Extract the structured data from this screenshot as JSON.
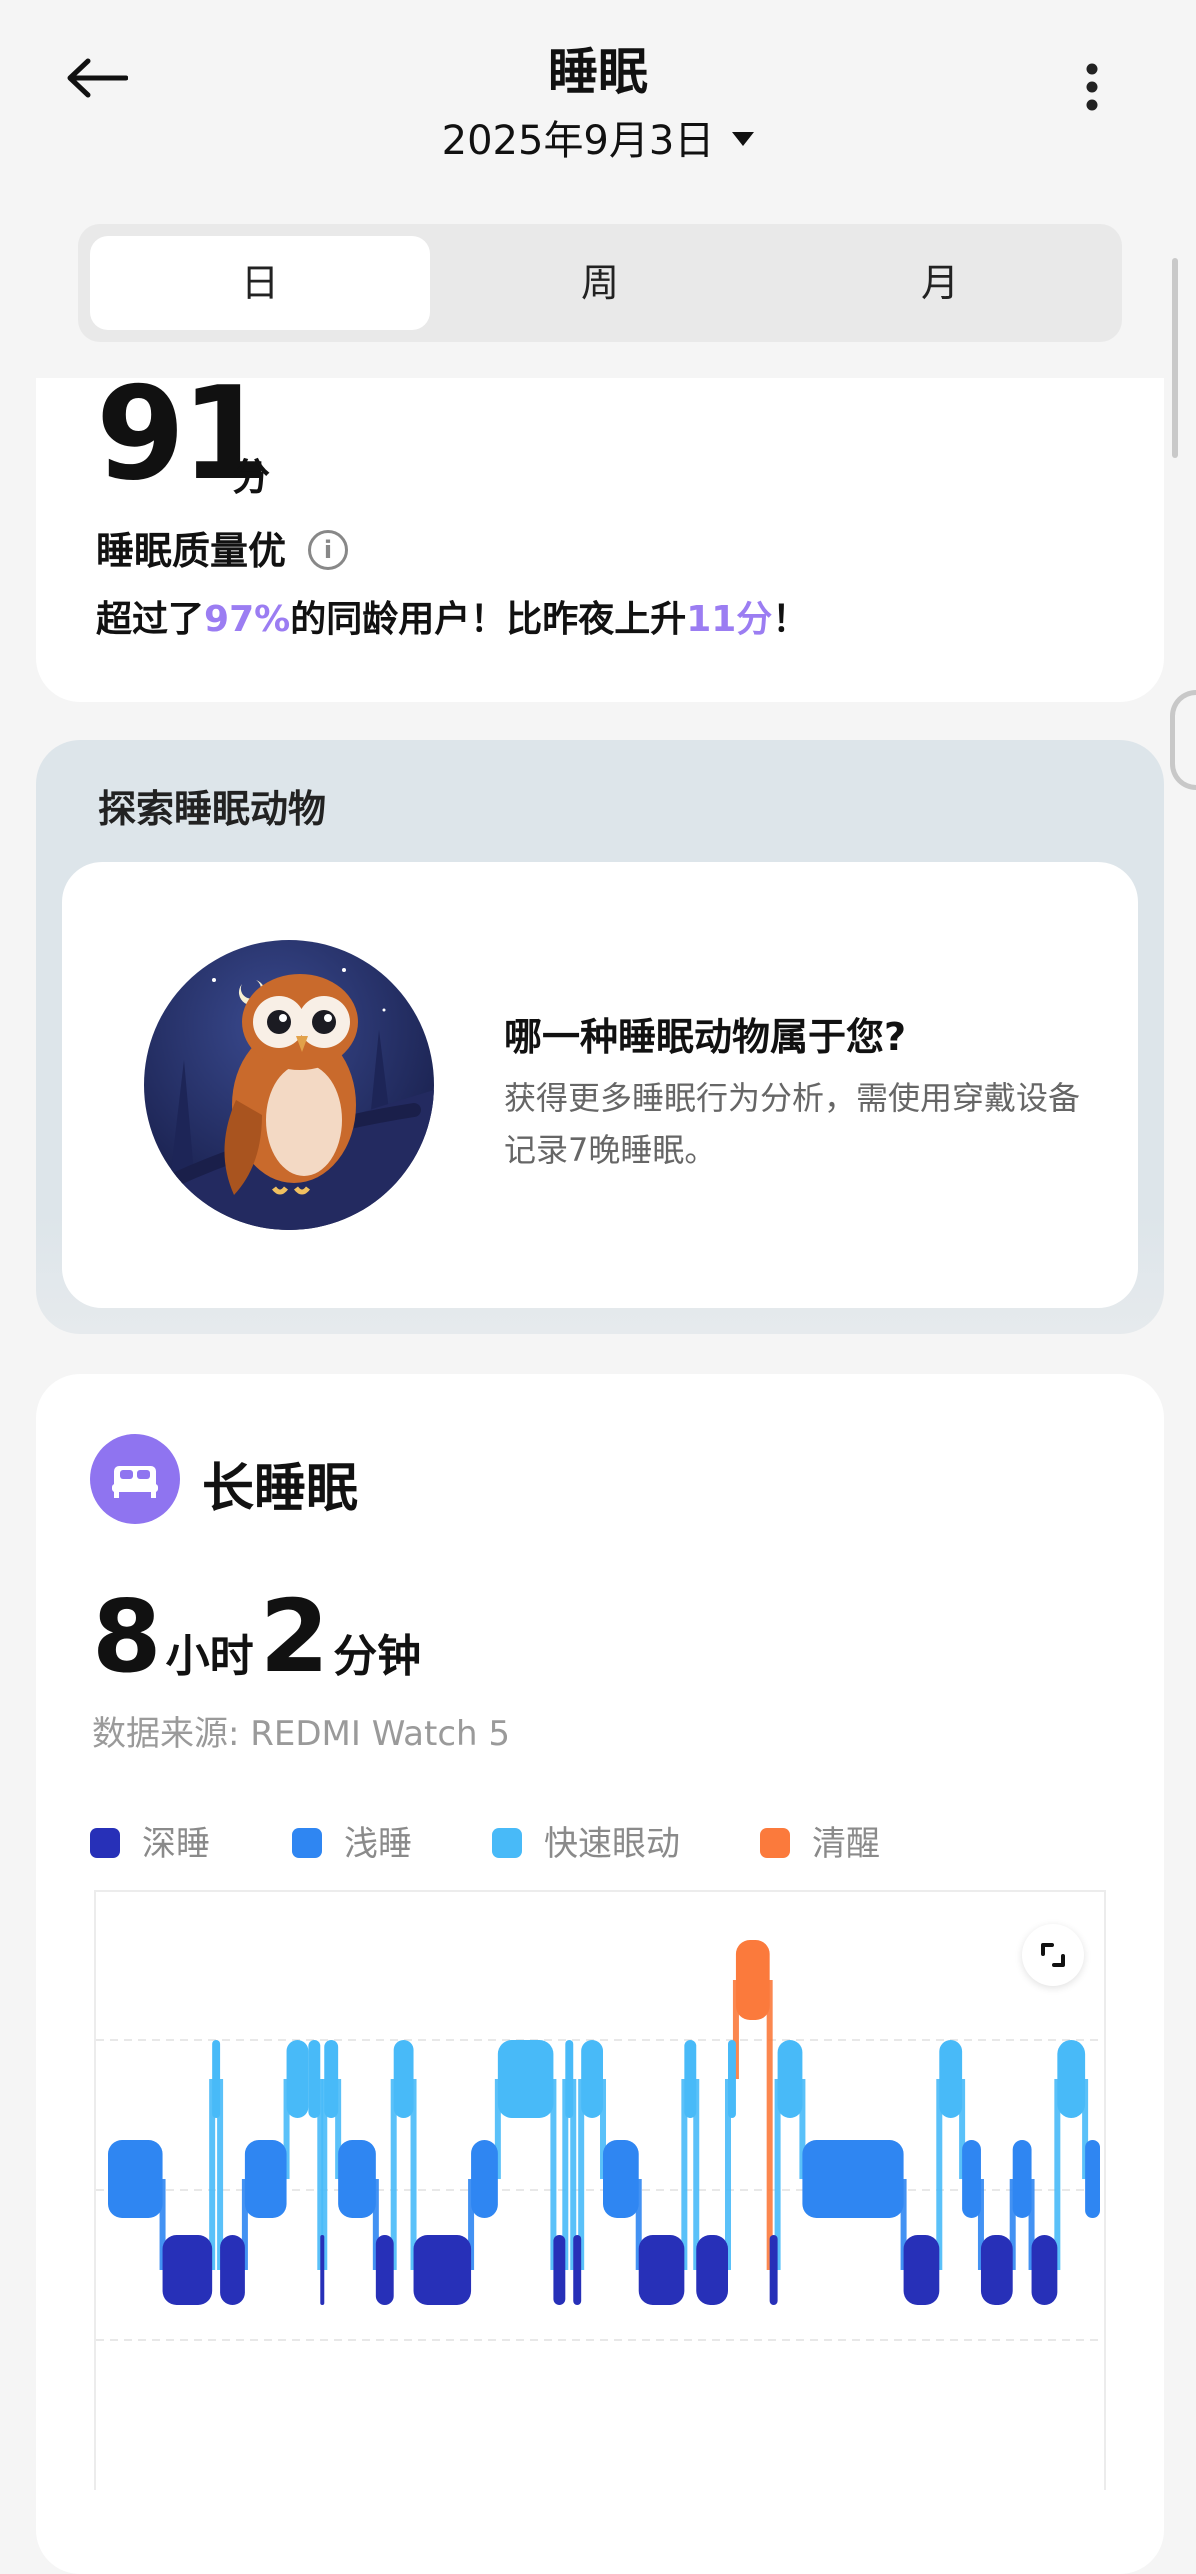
{
  "header": {
    "title": "睡眠",
    "date": "2025年9月3日"
  },
  "tabs": [
    "日",
    "周",
    "月"
  ],
  "score": {
    "value": "91",
    "unit": "分",
    "quality": "睡眠质量优",
    "compare_prefix": "超过了",
    "compare_pct": "97%",
    "compare_mid": "的同龄用户！比昨夜上升",
    "compare_delta": "11分",
    "compare_suffix": "！"
  },
  "animal": {
    "title": "探索睡眠动物",
    "question": "哪一种睡眠动物属于您?",
    "desc": "获得更多睡眠行为分析，需使用穿戴设备记录7晚睡眠。"
  },
  "sleep": {
    "title": "长睡眠",
    "hours": "8",
    "hours_unit": "小时",
    "minutes": "2",
    "minutes_unit": "分钟",
    "source": "数据来源: REDMI Watch 5"
  },
  "legend": [
    {
      "label": "深睡",
      "color": "#2730b8"
    },
    {
      "label": "浅睡",
      "color": "#2f86f2"
    },
    {
      "label": "快速眼动",
      "color": "#48baf8"
    },
    {
      "label": "清醒",
      "color": "#fb7a3c"
    }
  ],
  "chart_data": {
    "type": "bar",
    "stages": [
      "清醒",
      "快速眼动",
      "浅睡",
      "深睡"
    ],
    "segments": [
      {
        "stage": "浅睡",
        "start": 0,
        "end": 5.5
      },
      {
        "stage": "深睡",
        "start": 5.5,
        "end": 10.5
      },
      {
        "stage": "快速眼动",
        "start": 10.5,
        "end": 11.3
      },
      {
        "stage": "深睡",
        "start": 11.3,
        "end": 13.8
      },
      {
        "stage": "浅睡",
        "start": 13.8,
        "end": 18.0
      },
      {
        "stage": "快速眼动",
        "start": 18.0,
        "end": 20.2
      },
      {
        "stage": "快速眼动",
        "start": 20.2,
        "end": 21.4
      },
      {
        "stage": "深睡",
        "start": 21.4,
        "end": 21.8
      },
      {
        "stage": "快速眼动",
        "start": 21.8,
        "end": 23.2
      },
      {
        "stage": "浅睡",
        "start": 23.2,
        "end": 27.0
      },
      {
        "stage": "深睡",
        "start": 27.0,
        "end": 28.8
      },
      {
        "stage": "快速眼动",
        "start": 28.8,
        "end": 30.8
      },
      {
        "stage": "深睡",
        "start": 30.8,
        "end": 36.6
      },
      {
        "stage": "浅睡",
        "start": 36.6,
        "end": 39.3
      },
      {
        "stage": "快速眼动",
        "start": 39.3,
        "end": 44.9
      },
      {
        "stage": "深睡",
        "start": 44.9,
        "end": 46.1
      },
      {
        "stage": "快速眼动",
        "start": 46.1,
        "end": 46.9
      },
      {
        "stage": "深睡",
        "start": 46.9,
        "end": 47.7
      },
      {
        "stage": "快速眼动",
        "start": 47.7,
        "end": 49.9
      },
      {
        "stage": "浅睡",
        "start": 49.9,
        "end": 53.5
      },
      {
        "stage": "深睡",
        "start": 53.5,
        "end": 58.1
      },
      {
        "stage": "快速眼动",
        "start": 58.1,
        "end": 59.3
      },
      {
        "stage": "深睡",
        "start": 59.3,
        "end": 62.5
      },
      {
        "stage": "快速眼动",
        "start": 62.5,
        "end": 63.3
      },
      {
        "stage": "清醒",
        "start": 63.3,
        "end": 66.7
      },
      {
        "stage": "深睡",
        "start": 66.7,
        "end": 67.5
      },
      {
        "stage": "快速眼动",
        "start": 67.5,
        "end": 70.0
      },
      {
        "stage": "浅睡",
        "start": 70.0,
        "end": 80.2
      },
      {
        "stage": "深睡",
        "start": 80.2,
        "end": 83.8
      },
      {
        "stage": "快速眼动",
        "start": 83.8,
        "end": 86.1
      },
      {
        "stage": "浅睡",
        "start": 86.1,
        "end": 88.0
      },
      {
        "stage": "深睡",
        "start": 88.0,
        "end": 91.2
      },
      {
        "stage": "浅睡",
        "start": 91.2,
        "end": 93.1
      },
      {
        "stage": "深睡",
        "start": 93.1,
        "end": 95.7
      },
      {
        "stage": "快速眼动",
        "start": 95.7,
        "end": 98.5
      },
      {
        "stage": "浅睡",
        "start": 98.5,
        "end": 100
      }
    ],
    "grid": true
  }
}
